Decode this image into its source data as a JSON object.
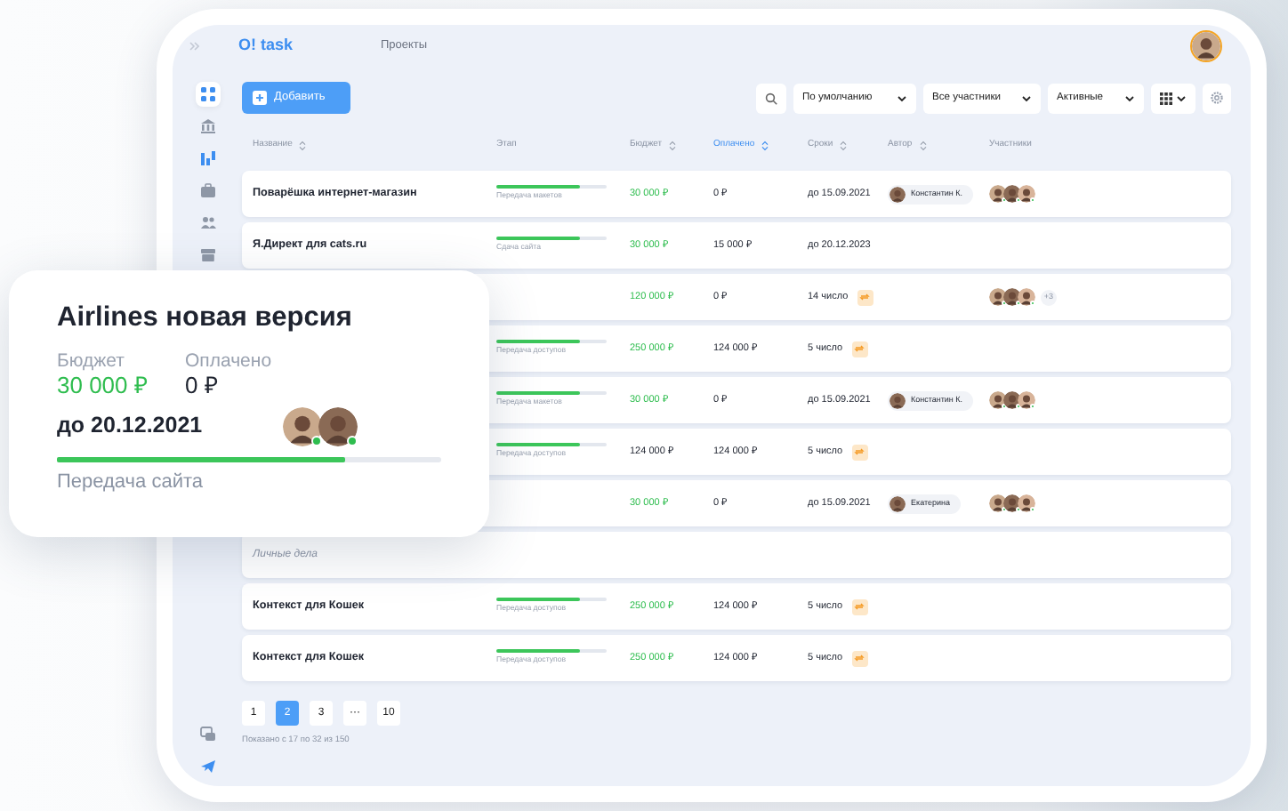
{
  "header": {
    "logo": "O! task",
    "section": "Проекты"
  },
  "sidebar": {
    "top": [
      {
        "kind": "grid",
        "selected": true
      },
      {
        "kind": "bank",
        "selected": false
      },
      {
        "kind": "chart",
        "selected": false
      },
      {
        "kind": "briefcase",
        "selected": false
      },
      {
        "kind": "people",
        "selected": false
      },
      {
        "kind": "box",
        "selected": false
      }
    ],
    "bottom": [
      {
        "kind": "chat",
        "selected": false
      },
      {
        "kind": "send",
        "selected": false
      }
    ]
  },
  "toolbar": {
    "add_button": "Добавить",
    "filters": [
      "По умолчанию",
      "Все участники",
      "Активные"
    ]
  },
  "columns": [
    {
      "label": "Название",
      "sortable": true,
      "selected": false
    },
    {
      "label": "Этап",
      "sortable": false,
      "selected": false
    },
    {
      "label": "Бюджет",
      "sortable": true,
      "selected": false
    },
    {
      "label": "Оплачено",
      "sortable": true,
      "selected": true
    },
    {
      "label": "Сроки",
      "sortable": true,
      "selected": false
    },
    {
      "label": "Автор",
      "sortable": true,
      "selected": false
    },
    {
      "label": "Участники",
      "sortable": false,
      "selected": false
    }
  ],
  "rows": [
    {
      "kind": "project",
      "name": "Поварёшка интернет-магазин",
      "stage": {
        "label": "Передача макетов",
        "level": 0.75
      },
      "budget": "30 000 ₽",
      "budget_highlight": true,
      "paid": "0 ₽",
      "due": "до 15.09.2021",
      "repeat": false,
      "author": "Константин К.",
      "participants": [
        {
          "online": true
        },
        {
          "online": true
        },
        {
          "online": true
        }
      ]
    },
    {
      "kind": "project",
      "name": "Я.Директ для cats.ru",
      "stage": {
        "label": "Сдача сайта",
        "level": 0.75
      },
      "budget": "30 000 ₽",
      "budget_highlight": true,
      "paid": "15 000 ₽",
      "due": "до 20.12.2023",
      "repeat": false
    },
    {
      "kind": "project",
      "budget": "120 000 ₽",
      "budget_highlight": true,
      "paid": "0 ₽",
      "due": "14 число",
      "repeat": true,
      "participants": [
        {
          "online": true
        },
        {
          "online": true
        },
        {
          "online": true
        }
      ],
      "more": "+3"
    },
    {
      "kind": "project",
      "stage": {
        "label": "Передача доступов",
        "level": 0.75
      },
      "budget": "250 000 ₽",
      "budget_highlight": true,
      "paid": "124 000 ₽",
      "due": "5 число",
      "repeat": true
    },
    {
      "kind": "project",
      "stage": {
        "label": "Передача макетов",
        "level": 0.75
      },
      "budget": "30 000 ₽",
      "budget_highlight": true,
      "paid": "0 ₽",
      "due": "до 15.09.2021",
      "repeat": false,
      "author": "Константин К.",
      "participants": [
        {
          "online": true
        },
        {
          "online": true
        },
        {
          "online": true
        }
      ]
    },
    {
      "kind": "project",
      "stage": {
        "label": "Передача доступов",
        "level": 0.75
      },
      "budget": "124 000 ₽",
      "budget_highlight": false,
      "paid": "124 000 ₽",
      "due": "5 число",
      "repeat": true
    },
    {
      "kind": "project",
      "budget": "30 000 ₽",
      "budget_highlight": true,
      "paid": "0 ₽",
      "due": "до 15.09.2021",
      "repeat": false,
      "author": "Екатерина",
      "participants": [
        {
          "online": true
        },
        {
          "online": true
        },
        {
          "online": true
        }
      ]
    },
    {
      "kind": "group",
      "name": "Личные дела"
    },
    {
      "kind": "project",
      "name": "Контекст для Кошек",
      "stage": {
        "label": "Передача доступов",
        "level": 0.75
      },
      "budget": "250 000 ₽",
      "budget_highlight": true,
      "paid": "124 000 ₽",
      "due": "5 число",
      "repeat": true
    },
    {
      "kind": "project",
      "name": "Контекст для Кошек",
      "stage": {
        "label": "Передача доступов",
        "level": 0.75
      },
      "budget": "250 000 ₽",
      "budget_highlight": true,
      "paid": "124 000 ₽",
      "due": "5 число",
      "repeat": true
    }
  ],
  "pagination": {
    "pages": [
      {
        "label": "1",
        "selected": false
      },
      {
        "label": "2",
        "selected": true
      },
      {
        "label": "3",
        "selected": false
      },
      {
        "label": "···",
        "selected": false
      },
      {
        "label": "10",
        "selected": false
      }
    ],
    "summary": "Показано с 17 по 32 из 150"
  },
  "card": {
    "title": "Airlines новая версия",
    "budget_label": "Бюджет",
    "budget": "30 000 ₽",
    "paid_label": "Оплачено",
    "paid": "0 ₽",
    "due": "до 20.12.2021",
    "participants": [
      {
        "online": true
      },
      {
        "online": true
      }
    ],
    "stage": {
      "label": "Передача сайта",
      "level": 0.75
    }
  }
}
